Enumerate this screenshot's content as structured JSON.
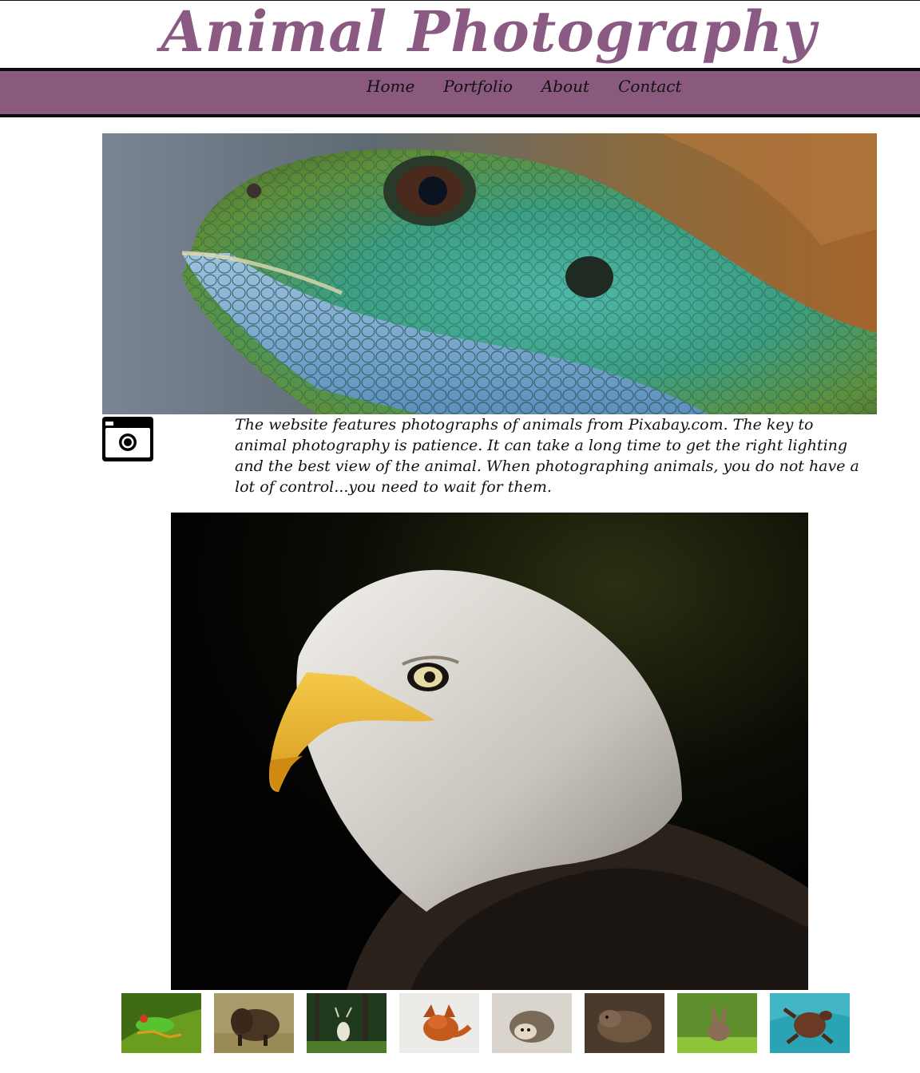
{
  "site": {
    "title": "Animal Photography"
  },
  "nav": {
    "items": [
      {
        "label": "Home"
      },
      {
        "label": "Portfolio"
      },
      {
        "label": "About"
      },
      {
        "label": "Contact"
      }
    ]
  },
  "intro": {
    "text": "The website features photographs of animals from Pixabay.com. The key to animal photography is patience. It can take a long time to get the right lighting and the best view of the animal. When photographing animals, you do not have a lot of control...you need to wait for them."
  },
  "images": {
    "hero": "lizard-photo",
    "feature": "bald-eagle-photo",
    "thumbnails": [
      "tree-frog",
      "bison",
      "deer",
      "fox",
      "hedgehog",
      "otter",
      "rabbit",
      "sea-turtle"
    ]
  },
  "colors": {
    "title": "#8a5a82",
    "nav_background": "#8a5a7e"
  }
}
